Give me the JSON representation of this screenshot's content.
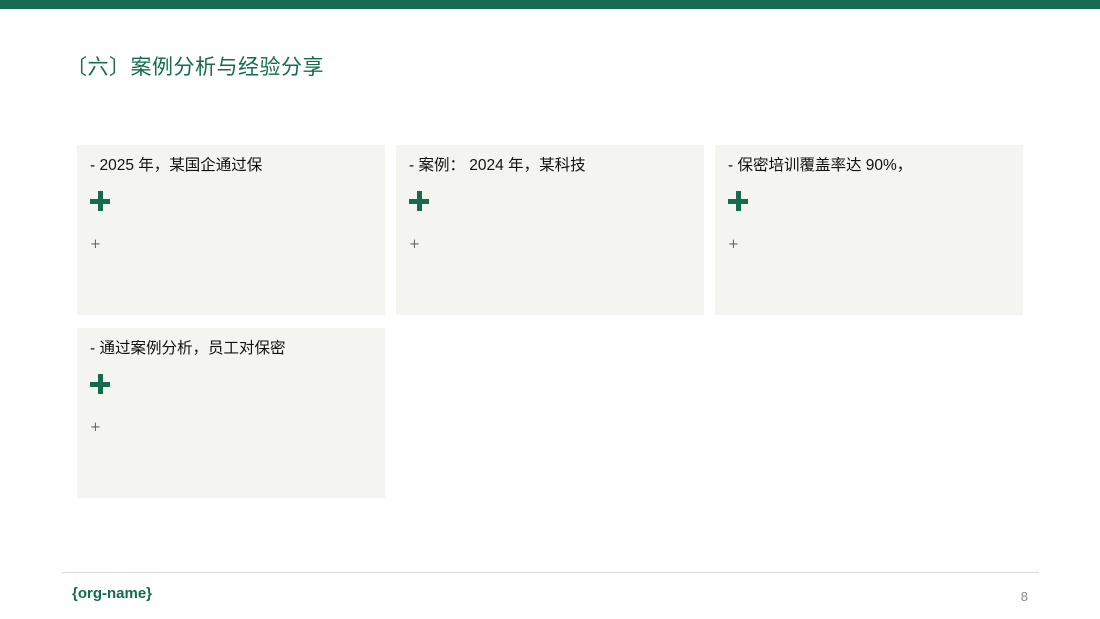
{
  "slide": {
    "title": "〔六〕案例分析与经验分享",
    "cards": [
      {
        "text": "- 2025 年，某国企通过保",
        "plus_icon": "plus-icon",
        "small_plus": "+"
      },
      {
        "text": "-  案例： 2024 年，某科技",
        "plus_icon": "plus-icon",
        "small_plus": "+"
      },
      {
        "text": "-  保密培训覆盖率达 90%，",
        "plus_icon": "plus-icon",
        "small_plus": "+"
      },
      {
        "text": "-  通过案例分析，员工对保密",
        "plus_icon": "plus-icon",
        "small_plus": "+"
      }
    ]
  },
  "footer": {
    "org_name": "{org-name}",
    "page_number": "8"
  },
  "colors": {
    "accent": "#146b4f",
    "card_background": "#f4f4f1"
  }
}
